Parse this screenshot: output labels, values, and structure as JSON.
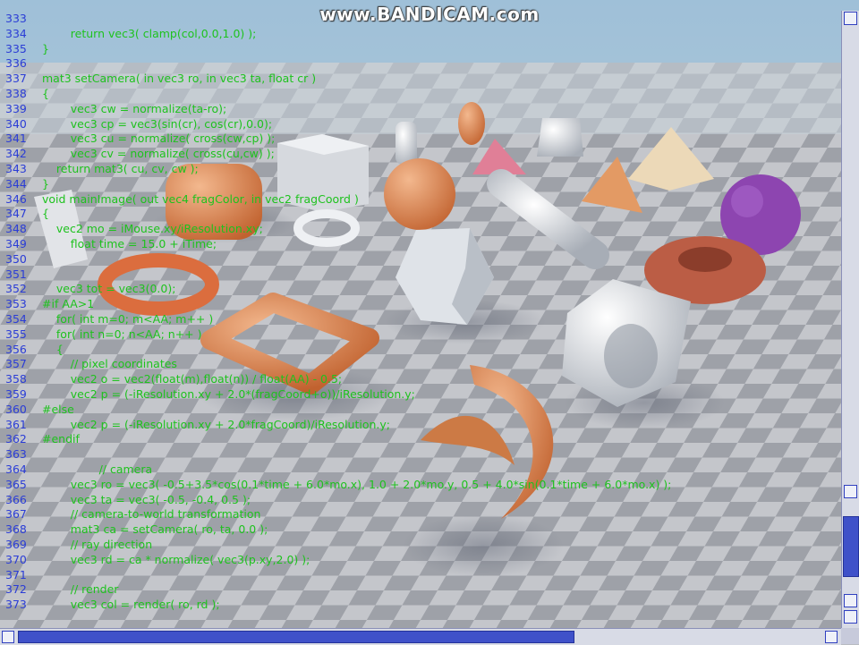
{
  "watermark": "www.BANDICAM.com",
  "editor": {
    "lines": [
      {
        "num": "333",
        "code": ""
      },
      {
        "num": "334",
        "code": "        return vec3( clamp(col,0.0,1.0) );"
      },
      {
        "num": "335",
        "code": "}"
      },
      {
        "num": "336",
        "code": ""
      },
      {
        "num": "337",
        "code": "mat3 setCamera( in vec3 ro, in vec3 ta, float cr )"
      },
      {
        "num": "338",
        "code": "{"
      },
      {
        "num": "339",
        "code": "        vec3 cw = normalize(ta-ro);"
      },
      {
        "num": "340",
        "code": "        vec3 cp = vec3(sin(cr), cos(cr),0.0);"
      },
      {
        "num": "341",
        "code": "        vec3 cu = normalize( cross(cw,cp) );"
      },
      {
        "num": "342",
        "code": "        vec3 cv = normalize( cross(cu,cw) );"
      },
      {
        "num": "343",
        "code": "    return mat3( cu, cv, cw );"
      },
      {
        "num": "344",
        "code": "}"
      },
      {
        "num": "346",
        "code": "void mainImage( out vec4 fragColor, in vec2 fragCoord )"
      },
      {
        "num": "347",
        "code": "{"
      },
      {
        "num": "348",
        "code": "    vec2 mo = iMouse.xy/iResolution.xy;"
      },
      {
        "num": "349",
        "code": "        float time = 15.0 + iTime;"
      },
      {
        "num": "350",
        "code": ""
      },
      {
        "num": "351",
        "code": ""
      },
      {
        "num": "352",
        "code": "    vec3 tot = vec3(0.0);"
      },
      {
        "num": "353",
        "code": "#if AA>1"
      },
      {
        "num": "354",
        "code": "    for( int m=0; m<AA; m++ )"
      },
      {
        "num": "355",
        "code": "    for( int n=0; n<AA; n++ )"
      },
      {
        "num": "356",
        "code": "    {"
      },
      {
        "num": "357",
        "code": "        // pixel coordinates"
      },
      {
        "num": "358",
        "code": "        vec2 o = vec2(float(m),float(n)) / float(AA) - 0.5;"
      },
      {
        "num": "359",
        "code": "        vec2 p = (-iResolution.xy + 2.0*(fragCoord+o))/iResolution.y;"
      },
      {
        "num": "360",
        "code": "#else"
      },
      {
        "num": "361",
        "code": "        vec2 p = (-iResolution.xy + 2.0*fragCoord)/iResolution.y;"
      },
      {
        "num": "362",
        "code": "#endif"
      },
      {
        "num": "363",
        "code": ""
      },
      {
        "num": "364",
        "code": "                // camera"
      },
      {
        "num": "365",
        "code": "        vec3 ro = vec3( -0.5+3.5*cos(0.1*time + 6.0*mo.x), 1.0 + 2.0*mo.y, 0.5 + 4.0*sin(0.1*time + 6.0*mo.x) );"
      },
      {
        "num": "366",
        "code": "        vec3 ta = vec3( -0.5, -0.4, 0.5 );"
      },
      {
        "num": "367",
        "code": "        // camera-to-world transformation"
      },
      {
        "num": "368",
        "code": "        mat3 ca = setCamera( ro, ta, 0.0 );"
      },
      {
        "num": "369",
        "code": "        // ray direction"
      },
      {
        "num": "370",
        "code": "        vec3 rd = ca * normalize( vec3(p.xy,2.0) );"
      },
      {
        "num": "371",
        "code": ""
      },
      {
        "num": "372",
        "code": "        // render"
      },
      {
        "num": "373",
        "code": "        vec3 col = render( ro, rd );"
      }
    ]
  },
  "colors": {
    "line_number": "#2b3dd6",
    "code_text": "#1ec21e",
    "scrollbar_thumb": "#3f51c9"
  }
}
